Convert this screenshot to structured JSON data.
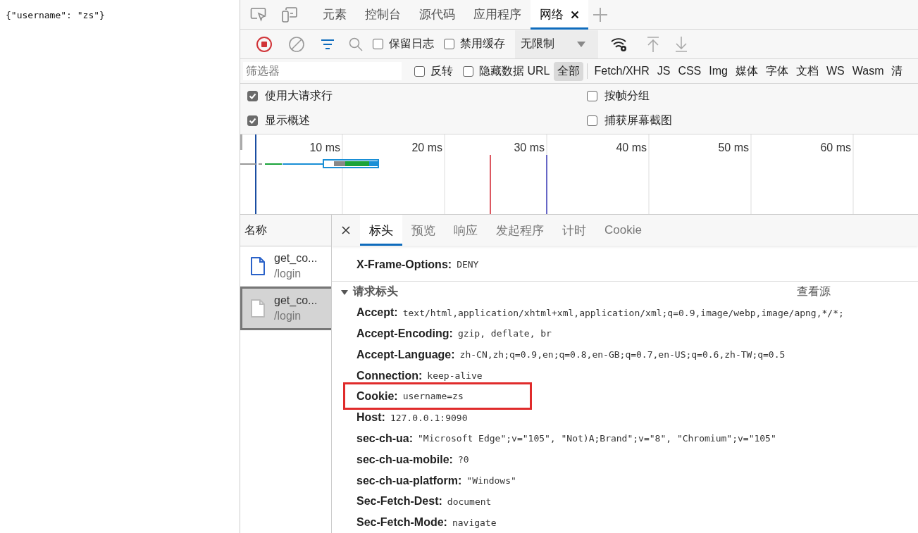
{
  "page_text": "{\"username\": \"zs\"}",
  "devtools": {
    "top_tabs": [
      {
        "label": "元素",
        "selected": false,
        "closable": false
      },
      {
        "label": "控制台",
        "selected": false,
        "closable": false
      },
      {
        "label": "源代码",
        "selected": false,
        "closable": false
      },
      {
        "label": "应用程序",
        "selected": false,
        "closable": false
      },
      {
        "label": "网络",
        "selected": true,
        "closable": true
      }
    ],
    "toolbar": {
      "recording": true,
      "preserve_log": {
        "label": "保留日志",
        "checked": false
      },
      "disable_cache": {
        "label": "禁用缓存",
        "checked": false
      },
      "throttle": "无限制"
    },
    "filter": {
      "placeholder": "筛选器",
      "invert": {
        "label": "反转",
        "checked": false
      },
      "hide_data_urls": {
        "label": "隐藏数据 URL",
        "checked": false
      },
      "types": [
        {
          "label": "全部",
          "selected": true
        },
        {
          "label": "Fetch/XHR",
          "selected": false
        },
        {
          "label": "JS",
          "selected": false
        },
        {
          "label": "CSS",
          "selected": false
        },
        {
          "label": "Img",
          "selected": false
        },
        {
          "label": "媒体",
          "selected": false
        },
        {
          "label": "字体",
          "selected": false
        },
        {
          "label": "文档",
          "selected": false
        },
        {
          "label": "WS",
          "selected": false
        },
        {
          "label": "Wasm",
          "selected": false
        },
        {
          "label": "清",
          "selected": false
        }
      ]
    },
    "options": [
      {
        "label": "使用大请求行",
        "checked": true
      },
      {
        "label": "按帧分组",
        "checked": false
      },
      {
        "label": "显示概述",
        "checked": true
      },
      {
        "label": "捕获屏幕截图",
        "checked": false
      }
    ],
    "timeline": {
      "ticks": [
        "10 ms",
        "20 ms",
        "30 ms",
        "40 ms",
        "50 ms",
        "60 ms"
      ]
    },
    "requests": {
      "column": "名称",
      "items": [
        {
          "name": "get_co...",
          "path": "/login",
          "selected": false
        },
        {
          "name": "get_co...",
          "path": "/login",
          "selected": true
        }
      ]
    },
    "details": {
      "tabs": [
        {
          "label": "标头",
          "selected": true
        },
        {
          "label": "预览",
          "selected": false
        },
        {
          "label": "响应",
          "selected": false
        },
        {
          "label": "发起程序",
          "selected": false
        },
        {
          "label": "计时",
          "selected": false
        },
        {
          "label": "Cookie",
          "selected": false
        }
      ],
      "response_headers": [
        {
          "name": "X-Frame-Options:",
          "value": "DENY",
          "highlighted": false
        }
      ],
      "section": {
        "title": "请求标头",
        "expanded": true,
        "action": "查看源"
      },
      "request_headers": [
        {
          "name": "Accept:",
          "value": "text/html,application/xhtml+xml,application/xml;q=0.9,image/webp,image/apng,*/*;",
          "highlighted": false
        },
        {
          "name": "Accept-Encoding:",
          "value": "gzip, deflate, br",
          "highlighted": false
        },
        {
          "name": "Accept-Language:",
          "value": "zh-CN,zh;q=0.9,en;q=0.8,en-GB;q=0.7,en-US;q=0.6,zh-TW;q=0.5",
          "highlighted": false
        },
        {
          "name": "Connection:",
          "value": "keep-alive",
          "highlighted": false
        },
        {
          "name": "Cookie:",
          "value": "username=zs",
          "highlighted": true
        },
        {
          "name": "Host:",
          "value": "127.0.0.1:9090",
          "highlighted": false
        },
        {
          "name": "sec-ch-ua:",
          "value": "\"Microsoft Edge\";v=\"105\", \"Not)A;Brand\";v=\"8\", \"Chromium\";v=\"105\"",
          "highlighted": false
        },
        {
          "name": "sec-ch-ua-mobile:",
          "value": "?0",
          "highlighted": false
        },
        {
          "name": "sec-ch-ua-platform:",
          "value": "\"Windows\"",
          "highlighted": false
        },
        {
          "name": "Sec-Fetch-Dest:",
          "value": "document",
          "highlighted": false
        },
        {
          "name": "Sec-Fetch-Mode:",
          "value": "navigate",
          "highlighted": false
        }
      ]
    }
  }
}
